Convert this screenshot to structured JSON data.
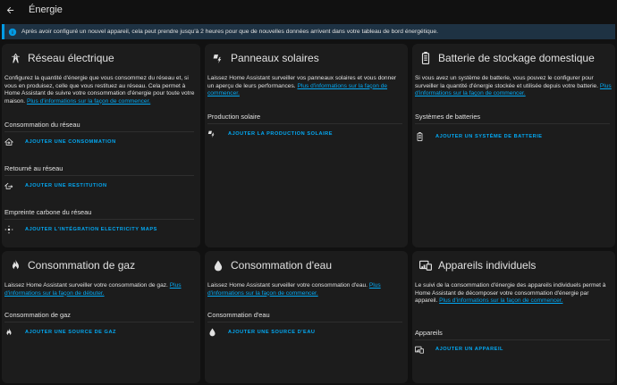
{
  "header": {
    "title": "Énergie"
  },
  "alert": {
    "text": "Après avoir configuré un nouvel appareil, cela peut prendre jusqu'à 2 heures pour que de nouvelles données arrivent dans votre tableau de bord énergétique."
  },
  "cards": {
    "grid": {
      "title": "Réseau électrique",
      "desc_text": "Configurez la quantité d'énergie que vous consommez du réseau et, si vous en produisez, celle que vous restituez au réseau. Cela permet à Home Assistant de suivre votre consommation d'énergie pour toute votre maison.",
      "desc_link": "Plus d'informations sur la façon de commencer.",
      "consumption_label": "Consommation du réseau",
      "add_consumption": "AJOUTER UNE CONSOMMATION",
      "return_label": "Retourné au réseau",
      "add_return": "AJOUTER UNE RESTITUTION",
      "co2_label": "Empreinte carbone du réseau",
      "add_co2": "AJOUTER L'INTÉGRATION ELECTRICITY MAPS"
    },
    "solar": {
      "title": "Panneaux solaires",
      "desc_text": "Laissez Home Assistant surveiller vos panneaux solaires et vous donner un aperçu de leurs performances.",
      "desc_link": "Plus d'informations sur la façon de commencer.",
      "production_label": "Production solaire",
      "add_production": "AJOUTER LA PRODUCTION SOLAIRE"
    },
    "battery": {
      "title": "Batterie de stockage domestique",
      "desc_text": "Si vous avez un système de batterie, vous pouvez le configurer pour surveiller la quantité d'énergie stockée et utilisée depuis votre batterie.",
      "desc_link": "Plus d'informations sur la façon de commencer.",
      "systems_label": "Systèmes de batteries",
      "add_system": "AJOUTER UN SYSTÈME DE BATTERIE"
    },
    "gas": {
      "title": "Consommation de gaz",
      "desc_text": "Laissez Home Assistant surveiller votre consommation de gaz.",
      "desc_link": "Plus d'informations sur la façon de débuter.",
      "consumption_label": "Consommation de gaz",
      "add_source": "AJOUTER UNE SOURCE DE GAZ"
    },
    "water": {
      "title": "Consommation d'eau",
      "desc_text": "Laissez Home Assistant surveiller votre consommation d'eau.",
      "desc_link": "Plus d'informations sur la façon de commencer.",
      "consumption_label": "Consommation d'eau",
      "add_source": "AJOUTER UNE SOURCE D'EAU"
    },
    "devices": {
      "title": "Appareils individuels",
      "desc_text": "Le suivi de la consommation d'énergie des appareils individuels permet à Home Assistant de décomposer votre consommation d'énergie par appareil.",
      "desc_link": "Plus d'informations sur la façon de commencer.",
      "devices_label": "Appareils",
      "add_device": "AJOUTER UN APPAREIL"
    }
  },
  "colors": {
    "accent": "#03a9f4",
    "card_bg": "#1c1c1c",
    "page_bg": "#111111",
    "alert_bg": "#1e3243"
  }
}
